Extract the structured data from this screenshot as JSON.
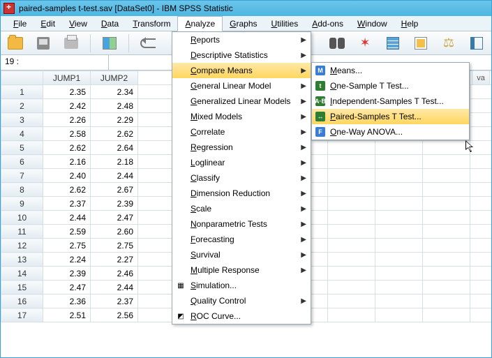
{
  "title": "paired-samples t-test.sav [DataSet0] - IBM SPSS Statistic",
  "menubar": [
    "File",
    "Edit",
    "View",
    "Data",
    "Transform",
    "Analyze",
    "Graphs",
    "Utilities",
    "Add-ons",
    "Window",
    "Help"
  ],
  "active_menu_index": 5,
  "selector_row": {
    "label": "19 :",
    "value": ""
  },
  "columns": [
    "JUMP1",
    "JUMP2"
  ],
  "var_stub": "va",
  "rows": [
    {
      "n": 1,
      "a": "2.35",
      "b": "2.34"
    },
    {
      "n": 2,
      "a": "2.42",
      "b": "2.48"
    },
    {
      "n": 3,
      "a": "2.26",
      "b": "2.29"
    },
    {
      "n": 4,
      "a": "2.58",
      "b": "2.62"
    },
    {
      "n": 5,
      "a": "2.62",
      "b": "2.64"
    },
    {
      "n": 6,
      "a": "2.16",
      "b": "2.18"
    },
    {
      "n": 7,
      "a": "2.40",
      "b": "2.44"
    },
    {
      "n": 8,
      "a": "2.62",
      "b": "2.67"
    },
    {
      "n": 9,
      "a": "2.37",
      "b": "2.39"
    },
    {
      "n": 10,
      "a": "2.44",
      "b": "2.47"
    },
    {
      "n": 11,
      "a": "2.59",
      "b": "2.60"
    },
    {
      "n": 12,
      "a": "2.75",
      "b": "2.75"
    },
    {
      "n": 13,
      "a": "2.24",
      "b": "2.27"
    },
    {
      "n": 14,
      "a": "2.39",
      "b": "2.46"
    },
    {
      "n": 15,
      "a": "2.47",
      "b": "2.44"
    },
    {
      "n": 16,
      "a": "2.36",
      "b": "2.37"
    },
    {
      "n": 17,
      "a": "2.51",
      "b": "2.56"
    }
  ],
  "analyze_menu": [
    {
      "label": "Reports",
      "sub": true
    },
    {
      "label": "Descriptive Statistics",
      "sub": true
    },
    {
      "label": "Compare Means",
      "sub": true,
      "highlight": true
    },
    {
      "label": "General Linear Model",
      "sub": true
    },
    {
      "label": "Generalized Linear Models",
      "sub": true
    },
    {
      "label": "Mixed Models",
      "sub": true
    },
    {
      "label": "Correlate",
      "sub": true
    },
    {
      "label": "Regression",
      "sub": true
    },
    {
      "label": "Loglinear",
      "sub": true
    },
    {
      "label": "Classify",
      "sub": true
    },
    {
      "label": "Dimension Reduction",
      "sub": true
    },
    {
      "label": "Scale",
      "sub": true
    },
    {
      "label": "Nonparametric Tests",
      "sub": true
    },
    {
      "label": "Forecasting",
      "sub": true
    },
    {
      "label": "Survival",
      "sub": true
    },
    {
      "label": "Multiple Response",
      "sub": true
    },
    {
      "label": "Simulation...",
      "sub": false,
      "icon": "sim"
    },
    {
      "label": "Quality Control",
      "sub": true
    },
    {
      "label": "ROC Curve...",
      "sub": false,
      "icon": "roc"
    }
  ],
  "compare_submenu": [
    {
      "label": "Means...",
      "icon": "M",
      "color": "#3a7dd2"
    },
    {
      "label": "One-Sample T Test...",
      "icon": "t",
      "color": "#2e7d32"
    },
    {
      "label": "Independent-Samples T Test...",
      "icon": "A·B",
      "color": "#2e7d32"
    },
    {
      "label": "Paired-Samples T Test...",
      "icon": "↔",
      "color": "#2e7d32",
      "highlight": true
    },
    {
      "label": "One-Way ANOVA...",
      "icon": "F",
      "color": "#3a7dd2"
    }
  ]
}
